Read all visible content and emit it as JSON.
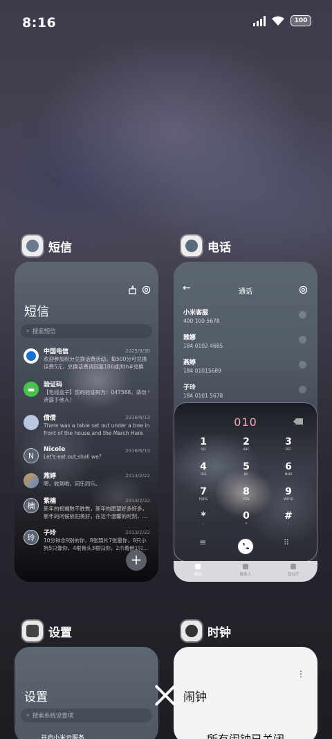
{
  "status_bar": {
    "time": "8:16",
    "battery": "100"
  },
  "apps": {
    "messages": {
      "name": "短信",
      "title": "短信",
      "search_placeholder": "搜索短信",
      "threads": [
        {
          "name": "中国电信",
          "date": "2025/9/30",
          "preview": "欢迎参加积分兑换话费活动，每500分可兑换话费5元，兑换话费请回复106或jfdh#兑换",
          "avatar_color": "#1b6fd1"
        },
        {
          "name": "验证码",
          "date": "",
          "preview": "【毛线盒子】您的验证码为：047588，请勿泄露于他人！",
          "avatar_color": "#4cc24e"
        },
        {
          "name": "倩倩",
          "date": "2016/6/13",
          "preview": "There was a table set out under a tree in front of the house,and the March Hare an...",
          "avatar_color": "#b8c8e0"
        },
        {
          "name": "Nicole",
          "initial": "N",
          "date": "2016/6/13",
          "preview": "Let's eat out,shall we?",
          "avatar_color": "#5a6272"
        },
        {
          "name": "燕婷",
          "date": "2013/2/22",
          "preview": "嗯，收到啦，回乐同乐。",
          "avatar_color": "#d29a4a"
        },
        {
          "name": "紫楠",
          "initial": "楠",
          "date": "2013/2/22",
          "preview": "新年的祝福数不胜数，新年的愿望好多好多，新年的问候依旧美好，在这个温馨的时刻，...",
          "avatar_color": "#5a6272"
        },
        {
          "name": "子玲",
          "initial": "玲",
          "date": "2013/2/22",
          "preview": "10分钟念9别的你，8张照片7张最你，6只小狗5只像你，4根骨头3根归你，2爪着他1只...",
          "avatar_color": "#5a6272"
        }
      ]
    },
    "phone": {
      "name": "电话",
      "title": "通话",
      "contacts": [
        {
          "name": "小米客服",
          "number": "400 100 5678"
        },
        {
          "name": "雅娜",
          "number": "184 0102 4685"
        },
        {
          "name": "燕婷",
          "number": "184 01015689"
        },
        {
          "name": "子玲",
          "number": "184 0101 5678"
        }
      ],
      "dial_input": "010",
      "keys": [
        {
          "d": "1",
          "l": "QO"
        },
        {
          "d": "2",
          "l": "ABC"
        },
        {
          "d": "3",
          "l": "DEF"
        },
        {
          "d": "4",
          "l": "GHI"
        },
        {
          "d": "5",
          "l": "JKL"
        },
        {
          "d": "6",
          "l": "MNO"
        },
        {
          "d": "7",
          "l": "PQRS"
        },
        {
          "d": "8",
          "l": "TUV"
        },
        {
          "d": "9",
          "l": "WXYZ"
        },
        {
          "d": "*",
          "l": ","
        },
        {
          "d": "0",
          "l": "+"
        },
        {
          "d": "#",
          "l": ";"
        }
      ],
      "tabs": [
        "通话",
        "联系人",
        "营业厅"
      ]
    },
    "settings": {
      "name": "设置",
      "title": "设置",
      "search_placeholder": "搜索系统设置项",
      "first_item": "开启小米云服务"
    },
    "clock": {
      "name": "时钟",
      "title": "闹钟",
      "status": "所有闹钟已关闭"
    }
  }
}
